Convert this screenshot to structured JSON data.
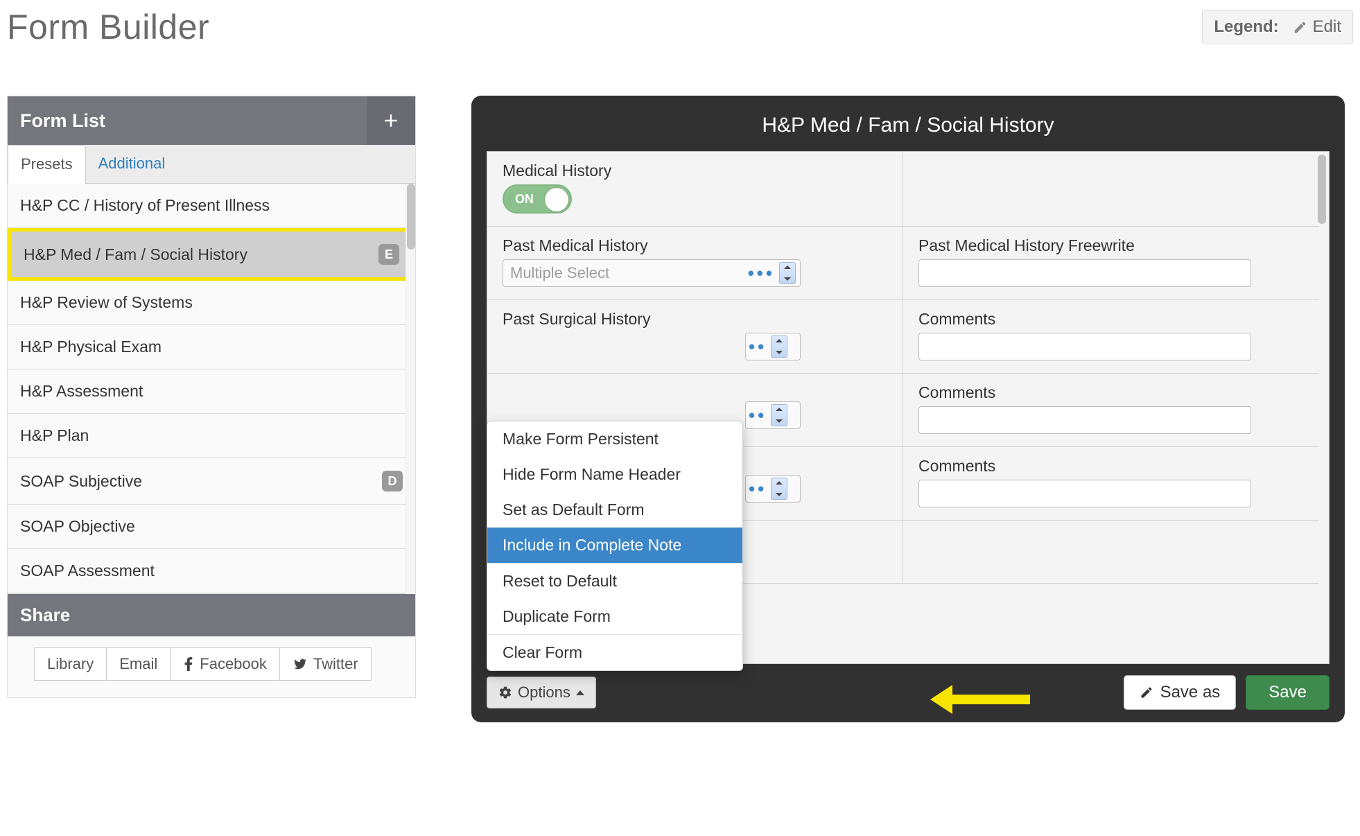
{
  "header": {
    "title": "Form Builder",
    "legend_label": "Legend:",
    "edit_label": "Edit"
  },
  "sidebar": {
    "title": "Form List",
    "tabs": {
      "presets": "Presets",
      "additional": "Additional"
    },
    "items": [
      {
        "label": "H&P CC / History of Present Illness",
        "badge": "",
        "selected": false
      },
      {
        "label": "H&P Med / Fam / Social History",
        "badge": "E",
        "selected": true
      },
      {
        "label": "H&P Review of Systems",
        "badge": "",
        "selected": false
      },
      {
        "label": "H&P Physical Exam",
        "badge": "",
        "selected": false
      },
      {
        "label": "H&P Assessment",
        "badge": "",
        "selected": false
      },
      {
        "label": "H&P Plan",
        "badge": "",
        "selected": false
      },
      {
        "label": "SOAP Subjective",
        "badge": "D",
        "selected": false
      },
      {
        "label": "SOAP Objective",
        "badge": "",
        "selected": false
      },
      {
        "label": "SOAP Assessment",
        "badge": "",
        "selected": false
      }
    ],
    "share": {
      "title": "Share",
      "buttons": {
        "library": "Library",
        "email": "Email",
        "facebook": "Facebook",
        "twitter": "Twitter"
      }
    }
  },
  "editor": {
    "title": "H&P Med / Fam / Social History",
    "rows": {
      "r0": {
        "left_label": "Medical History",
        "toggle": "ON"
      },
      "r1": {
        "left_label": "Past Medical History",
        "select_text": "Multiple Select",
        "right_label": "Past Medical History Freewrite"
      },
      "r2": {
        "left_label": "Past Surgical History",
        "right_label": "Comments"
      },
      "r3": {
        "right_label": "Comments"
      },
      "r4": {
        "right_label": "Comments"
      }
    },
    "options_menu": [
      "Make Form Persistent",
      "Hide Form Name Header",
      "Set as Default Form",
      "Include in Complete Note",
      "Reset to Default",
      "Duplicate Form",
      "Clear Form"
    ],
    "footer": {
      "options": "Options",
      "save_as": "Save as",
      "save": "Save"
    }
  }
}
